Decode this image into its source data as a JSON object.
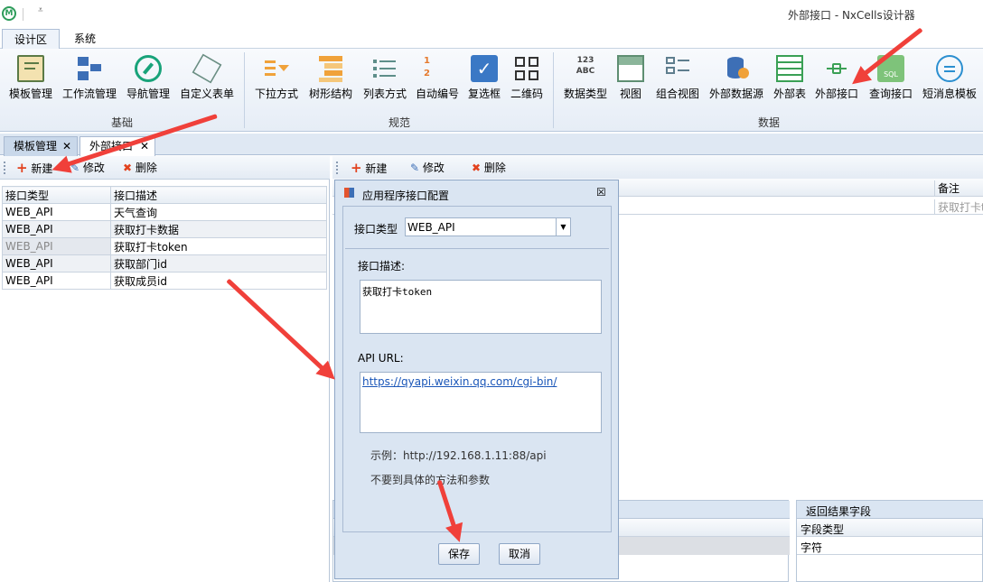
{
  "app": {
    "title": "外部接口 - NxCells设计器"
  },
  "ribbon": {
    "tabs": [
      {
        "label": "设计区"
      },
      {
        "label": "系统"
      }
    ],
    "groups": [
      {
        "label": "基础",
        "buttons": [
          {
            "label": "模板管理"
          },
          {
            "label": "工作流管理"
          },
          {
            "label": "导航管理"
          },
          {
            "label": "自定义表单"
          }
        ]
      },
      {
        "label": "规范",
        "buttons": [
          {
            "label": "下拉方式"
          },
          {
            "label": "树形结构"
          },
          {
            "label": "列表方式"
          },
          {
            "label": "自动编号"
          },
          {
            "label": "复选框"
          },
          {
            "label": "二维码"
          }
        ]
      },
      {
        "label": "数据",
        "buttons": [
          {
            "label": "数据类型"
          },
          {
            "label": "视图"
          },
          {
            "label": "组合视图"
          },
          {
            "label": "外部数据源"
          },
          {
            "label": "外部表"
          },
          {
            "label": "外部接口"
          },
          {
            "label": "查询接口"
          },
          {
            "label": "短消息模板"
          }
        ]
      }
    ]
  },
  "doc_tabs": [
    {
      "label": "模板管理"
    },
    {
      "label": "外部接口"
    }
  ],
  "toolbar": {
    "new_label": "新建",
    "edit_label": "修改",
    "delete_label": "删除"
  },
  "left_table": {
    "headers": [
      "接口类型",
      "接口描述"
    ],
    "rows": [
      [
        "WEB_API",
        "天气查询"
      ],
      [
        "WEB_API",
        "获取打卡数据"
      ],
      [
        "WEB_API",
        "获取打卡token"
      ],
      [
        "WEB_API",
        "获取部门id"
      ],
      [
        "WEB_API",
        "获取成员id"
      ]
    ]
  },
  "right_table": {
    "header_note": "备注",
    "row_note": "获取打卡t"
  },
  "bottom_panel": {
    "title": "返回结果字段",
    "header_field_type": "字段类型",
    "row_field_type": "字符"
  },
  "dialog": {
    "title": "应用程序接口配置",
    "type_label": "接口类型",
    "type_value": "WEB_API",
    "desc_label": "接口描述:",
    "desc_value": "获取打卡token",
    "url_label": "API URL:",
    "url_value": "https://qyapi.weixin.qq.com/cgi-bin/",
    "example": "示例：http://192.168.1.11:88/api",
    "hint": "不要到具体的方法和参数",
    "save_label": "保存",
    "cancel_label": "取消"
  },
  "colors": {
    "accent": "#1e5fa8",
    "arrow": "#f0403a",
    "link": "#1a56b8"
  }
}
